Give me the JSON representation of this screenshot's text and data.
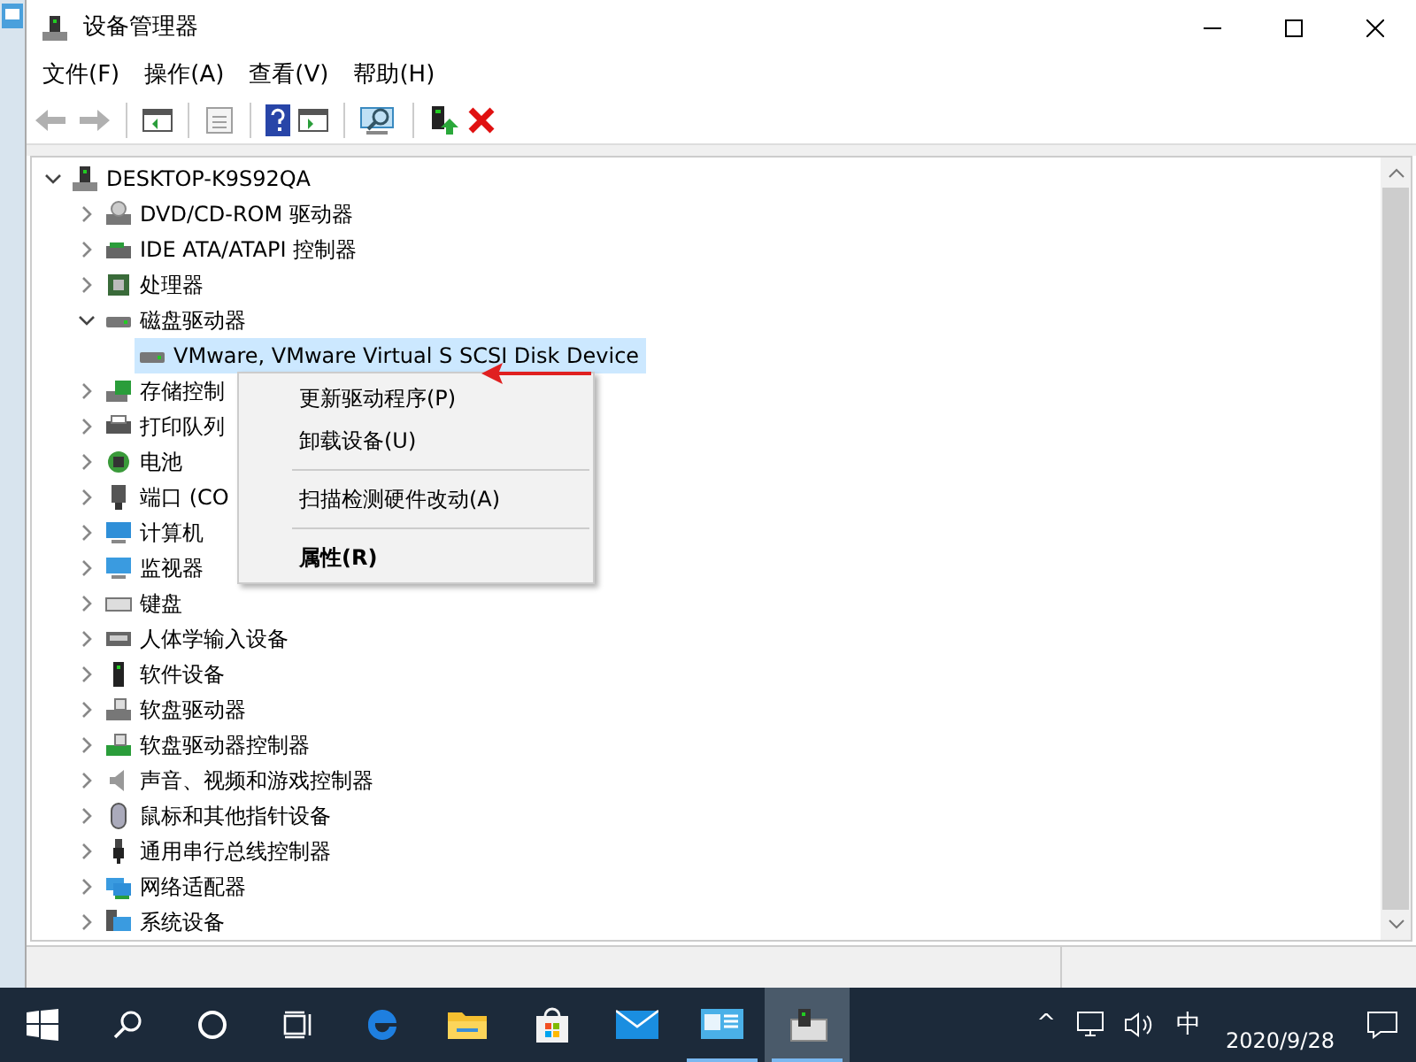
{
  "window": {
    "title": "设备管理器"
  },
  "menu": [
    "文件(F)",
    "操作(A)",
    "查看(V)",
    "帮助(H)"
  ],
  "toolbar": [
    {
      "kind": "back",
      "disabled": true
    },
    {
      "kind": "forward",
      "disabled": true
    },
    {
      "kind": "separator"
    },
    {
      "kind": "tree-pane",
      "disabled": false
    },
    {
      "kind": "separator"
    },
    {
      "kind": "properties",
      "disabled": true
    },
    {
      "kind": "separator"
    },
    {
      "kind": "help",
      "disabled": false
    },
    {
      "kind": "action-pane",
      "disabled": false
    },
    {
      "kind": "separator"
    },
    {
      "kind": "scan",
      "disabled": false
    },
    {
      "kind": "separator"
    },
    {
      "kind": "update",
      "disabled": false
    },
    {
      "kind": "uninstall",
      "disabled": false
    }
  ],
  "tree": {
    "label": "DESKTOP-K9S92QA",
    "expanded": true,
    "selected": false,
    "children": [
      {
        "label": "DVD/CD-ROM 驱动器",
        "expanded": false,
        "selected": false
      },
      {
        "label": "IDE ATA/ATAPI 控制器",
        "expanded": false,
        "selected": false
      },
      {
        "label": "处理器",
        "expanded": false,
        "selected": false
      },
      {
        "label": "磁盘驱动器",
        "expanded": true,
        "selected": false,
        "children": [
          {
            "label": "VMware, VMware Virtual S SCSI Disk Device",
            "selected": true
          }
        ]
      },
      {
        "label": "存储控制",
        "expanded": false,
        "selected": false
      },
      {
        "label": "打印队列",
        "expanded": false,
        "selected": false
      },
      {
        "label": "电池",
        "expanded": false,
        "selected": false
      },
      {
        "label": "端口 (CO",
        "expanded": false,
        "selected": false
      },
      {
        "label": "计算机",
        "expanded": false,
        "selected": false
      },
      {
        "label": "监视器",
        "expanded": false,
        "selected": false
      },
      {
        "label": "键盘",
        "expanded": false,
        "selected": false
      },
      {
        "label": "人体学输入设备",
        "expanded": false,
        "selected": false
      },
      {
        "label": "软件设备",
        "expanded": false,
        "selected": false
      },
      {
        "label": "软盘驱动器",
        "expanded": false,
        "selected": false
      },
      {
        "label": "软盘驱动器控制器",
        "expanded": false,
        "selected": false
      },
      {
        "label": "声音、视频和游戏控制器",
        "expanded": false,
        "selected": false
      },
      {
        "label": "鼠标和其他指针设备",
        "expanded": false,
        "selected": false
      },
      {
        "label": "通用串行总线控制器",
        "expanded": false,
        "selected": false
      },
      {
        "label": "网络适配器",
        "expanded": false,
        "selected": false
      },
      {
        "label": "系统设备",
        "expanded": false,
        "selected": false
      }
    ]
  },
  "context_menu": [
    {
      "kind": "item",
      "label": "更新驱动程序(P)",
      "bold": false
    },
    {
      "kind": "item",
      "label": "卸载设备(U)",
      "bold": false
    },
    {
      "kind": "separator"
    },
    {
      "kind": "item",
      "label": "扫描检测硬件改动(A)",
      "bold": false
    },
    {
      "kind": "separator"
    },
    {
      "kind": "item",
      "label": "属性(R)",
      "bold": true
    }
  ],
  "taskbar": {
    "apps": [
      {
        "kind": "start",
        "selected": false,
        "running": false
      },
      {
        "kind": "search",
        "selected": false,
        "running": false
      },
      {
        "kind": "cortana",
        "selected": false,
        "running": false
      },
      {
        "kind": "task-view",
        "selected": false,
        "running": false
      },
      {
        "kind": "edge",
        "selected": false,
        "running": false
      },
      {
        "kind": "explorer",
        "selected": false,
        "running": false
      },
      {
        "kind": "store",
        "selected": false,
        "running": false
      },
      {
        "kind": "mail",
        "selected": false,
        "running": false
      },
      {
        "kind": "control-panel",
        "selected": false,
        "running": true
      },
      {
        "kind": "device-manager",
        "selected": true,
        "running": true
      }
    ],
    "tray": {
      "chevron": "^",
      "ime": "中",
      "date": "2020/9/28"
    }
  }
}
